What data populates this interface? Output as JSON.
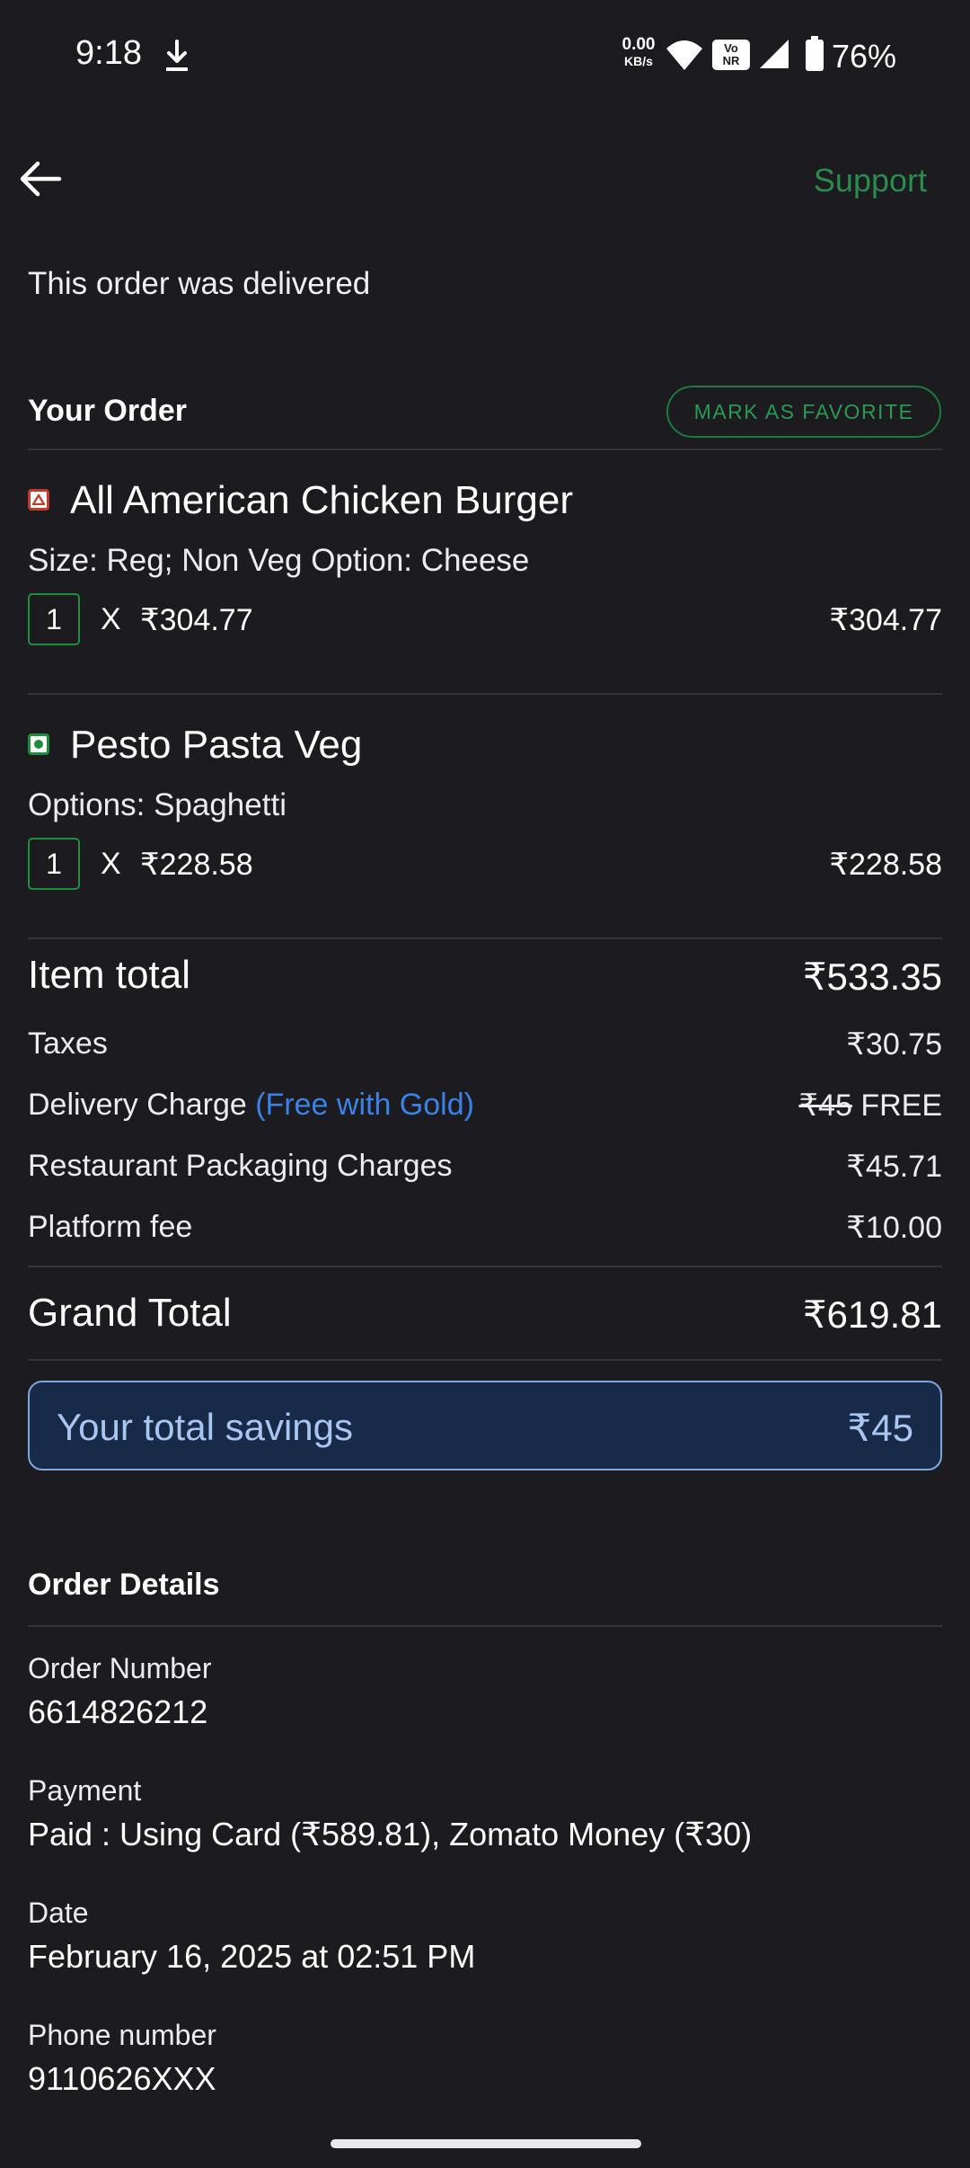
{
  "status_bar": {
    "time": "9:18",
    "net_speed_value": "0.00",
    "net_speed_unit": "KB/s",
    "volte_top": "Vo",
    "volte_bottom": "NR",
    "battery": "76%",
    "icons": [
      "download-icon",
      "wifi-icon",
      "volte-icon",
      "signal-icon",
      "battery-icon"
    ]
  },
  "header": {
    "back_icon": "arrow-left-icon",
    "support_label": "Support"
  },
  "order_status": "This order was delivered",
  "your_order": {
    "title": "Your Order",
    "favorite_label": "MARK AS FAVORITE",
    "items": [
      {
        "name": "All American Chicken Burger",
        "type": "non-veg",
        "description": "Size: Reg; Non Veg Option: Cheese",
        "quantity": "1",
        "times": "X",
        "unit_price": "₹304.77",
        "total": "₹304.77"
      },
      {
        "name": "Pesto Pasta Veg",
        "type": "veg",
        "description": "Options: Spaghetti",
        "quantity": "1",
        "times": "X",
        "unit_price": "₹228.58",
        "total": "₹228.58"
      }
    ]
  },
  "bill": {
    "item_total_label": "Item total",
    "item_total_value": "₹533.35",
    "taxes_label": "Taxes",
    "taxes_value": "₹30.75",
    "delivery_label": "Delivery Charge",
    "delivery_note": "(Free with Gold)",
    "delivery_original": "₹45",
    "delivery_value": "FREE",
    "packaging_label": "Restaurant Packaging Charges",
    "packaging_value": "₹45.71",
    "platform_label": "Platform fee",
    "platform_value": "₹10.00",
    "grand_total_label": "Grand Total",
    "grand_total_value": "₹619.81"
  },
  "savings": {
    "label": "Your total savings",
    "value": "₹45"
  },
  "order_details": {
    "title": "Order Details",
    "order_number_label": "Order Number",
    "order_number_value": "6614826212",
    "payment_label": "Payment",
    "payment_value": "Paid : Using Card (₹589.81), Zomato Money (₹30)",
    "date_label": "Date",
    "date_value": "February 16, 2025 at 02:51 PM",
    "phone_label": "Phone number",
    "phone_value": "9110626XXX"
  },
  "colors": {
    "background": "#1b1b20",
    "accent_green": "#2a8c4a",
    "gold_blue": "#3b82e6",
    "savings_bg": "#172a48",
    "savings_text": "#a9c6f2"
  }
}
